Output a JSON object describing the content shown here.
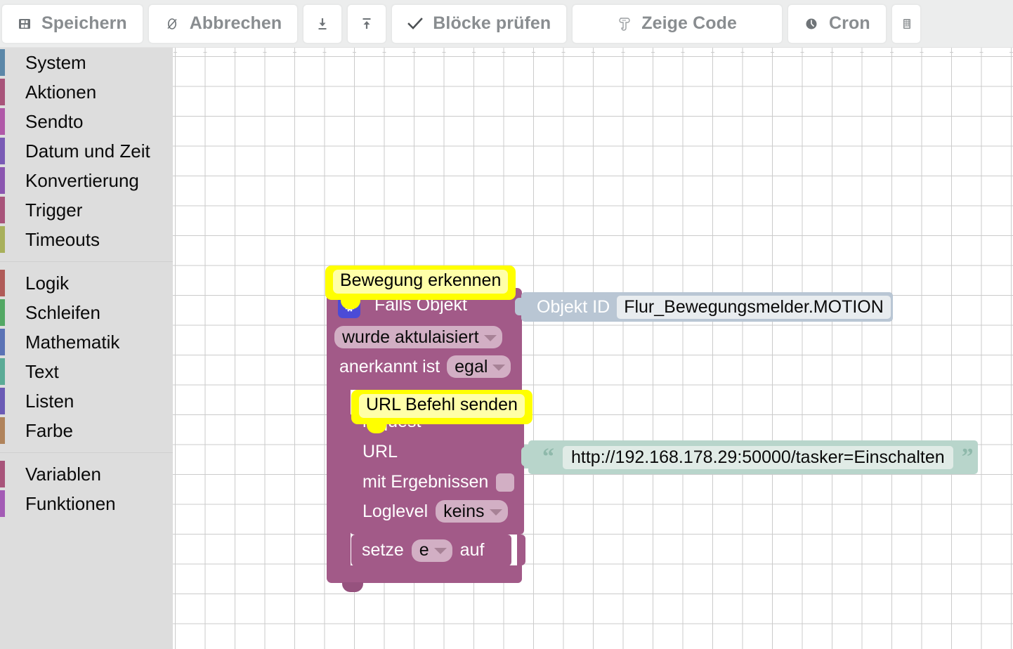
{
  "toolbar": {
    "buttons": [
      {
        "label": "Speichern",
        "icon": "save-icon",
        "icon_glyph": "▤"
      },
      {
        "label": "Abbrechen",
        "icon": "cancel-icon",
        "icon_glyph": "⊘"
      },
      {
        "label": "",
        "icon": "export-download-icon",
        "icon_glyph": "⤓"
      },
      {
        "label": "",
        "icon": "import-upload-icon",
        "icon_glyph": "⤒"
      },
      {
        "label": "Blöcke prüfen",
        "icon": "check-icon",
        "icon_glyph": "✔"
      },
      {
        "label": "Zeige Code",
        "icon": "code-scroll-icon",
        "icon_glyph": "Ὅc"
      },
      {
        "label": "Cron",
        "icon": "clock-icon",
        "icon_glyph": "◕"
      },
      {
        "label": "",
        "icon": "keyboard-grid-icon",
        "icon_glyph": "⌸"
      }
    ]
  },
  "sidebar": {
    "groups": [
      {
        "items": [
          {
            "label": "System",
            "color": "#5b87a8"
          },
          {
            "label": "Aktionen",
            "color": "#a8547a"
          },
          {
            "label": "Sendto",
            "color": "#b059a8"
          },
          {
            "label": "Datum und Zeit",
            "color": "#7a5bb5"
          },
          {
            "label": "Konvertierung",
            "color": "#8b56b0"
          },
          {
            "label": "Trigger",
            "color": "#a8547a"
          },
          {
            "label": "Timeouts",
            "color": "#a8b05b"
          }
        ]
      },
      {
        "items": [
          {
            "label": "Logik",
            "color": "#b05b58"
          },
          {
            "label": "Schleifen",
            "color": "#53a864"
          },
          {
            "label": "Mathematik",
            "color": "#5b73b5"
          },
          {
            "label": "Text",
            "color": "#5bab96"
          },
          {
            "label": "Listen",
            "color": "#6b5bb5"
          },
          {
            "label": "Farbe",
            "color": "#b0835b"
          }
        ]
      },
      {
        "items": [
          {
            "label": "Variablen",
            "color": "#a8547a"
          },
          {
            "label": "Funktionen",
            "color": "#a35bb5"
          }
        ]
      }
    ]
  },
  "workspace": {
    "comments": {
      "trigger_comment": "Bewegung erkennen",
      "url_comment": "URL Befehl senden"
    },
    "trigger_block": {
      "title": "Falls Objekt",
      "gear_icon": "gear-icon",
      "condition_dropdown": "wurde aktulaisiert",
      "ack_label": "anerkannt ist",
      "ack_dropdown": "egal",
      "object_id_label": "Objekt ID",
      "object_id_value": "Flur_Bewegungsmelder.MOTION"
    },
    "url_block": {
      "request_label": "request",
      "url_label": "URL",
      "results_label": "mit Ergebnissen",
      "results_checked": false,
      "loglevel_label": "Loglevel",
      "loglevel_value": "keins",
      "url_value": "http://192.168.178.29:50000/tasker=Einschalten"
    },
    "set_block": {
      "set_label": "setze",
      "variable": "e",
      "to_label": "auf"
    }
  },
  "colors": {
    "block_purple": "#a25a88",
    "block_field": "#d2afc4",
    "value_blue": "#b9c6d4",
    "value_mint": "#b8d5cb",
    "comment_yellow": "#ffff00",
    "gear_blue": "#4b4bd6",
    "toolbar_bg": "#eceded",
    "sidebar_bg": "#dddddd"
  }
}
